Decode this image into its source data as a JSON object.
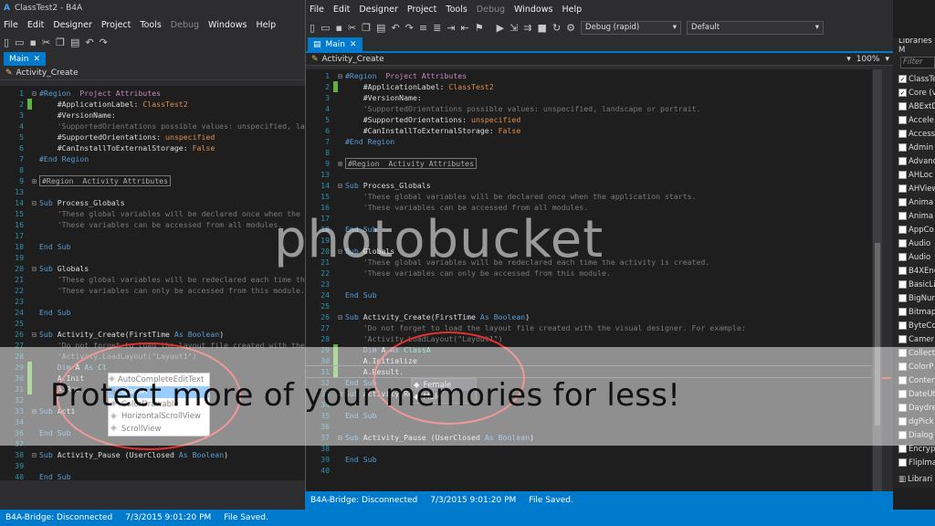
{
  "back_window": {
    "title": "ClassTest2 - B4A",
    "menu": [
      "File",
      "Edit",
      "Designer",
      "Project",
      "Tools",
      "Debug",
      "Windows",
      "Help"
    ],
    "tab": "Main",
    "sub_header": "Activity_Create",
    "status": [
      "B4A-Bridge: Disconnected",
      "7/3/2015 9:01:20 PM",
      "File Saved."
    ]
  },
  "front_window": {
    "menu": [
      "File",
      "Edit",
      "Designer",
      "Project",
      "Tools",
      "Debug",
      "Windows",
      "Help"
    ],
    "build_config": "Debug (rapid)",
    "device": "Default",
    "tab": "Main",
    "sub_header": "Activity_Create",
    "zoom": "100%",
    "status": [
      "B4A-Bridge: Disconnected",
      "7/3/2015 9:01:20 PM",
      "File Saved."
    ]
  },
  "libraries": {
    "header": "Libraries M",
    "filter_placeholder": "Filter",
    "items": [
      {
        "label": "ClassTe",
        "checked": true
      },
      {
        "label": "Core (v",
        "checked": true
      },
      {
        "label": "ABExtD",
        "checked": false
      },
      {
        "label": "Accele",
        "checked": false
      },
      {
        "label": "Access",
        "checked": false
      },
      {
        "label": "Admin",
        "checked": false
      },
      {
        "label": "Advanc",
        "checked": false
      },
      {
        "label": "AHLoc",
        "checked": false
      },
      {
        "label": "AHView",
        "checked": false
      },
      {
        "label": "Anima",
        "checked": false
      },
      {
        "label": "Anima",
        "checked": false
      },
      {
        "label": "AppCo",
        "checked": false
      },
      {
        "label": "Audio",
        "checked": false
      },
      {
        "label": "Audio",
        "checked": false
      },
      {
        "label": "B4XEnc",
        "checked": false
      },
      {
        "label": "BasicLi",
        "checked": false
      },
      {
        "label": "BigNur",
        "checked": false
      },
      {
        "label": "Bitmap",
        "checked": false
      },
      {
        "label": "ByteCo",
        "checked": false
      },
      {
        "label": "Camer",
        "checked": false
      },
      {
        "label": "Collect",
        "checked": false
      },
      {
        "label": "ColorP",
        "checked": false
      },
      {
        "label": "Conten",
        "checked": false
      },
      {
        "label": "DateUt",
        "checked": false
      },
      {
        "label": "Daydre",
        "checked": false
      },
      {
        "label": "dgPick",
        "checked": false
      },
      {
        "label": "Dialog",
        "checked": false
      },
      {
        "label": "Encryp",
        "checked": false
      },
      {
        "label": "FlipIma",
        "checked": false
      }
    ],
    "footer": "Librari"
  },
  "back_popup": {
    "items": [
      "AutoCompleteEditText",
      "ClassA",
      "ColorDrawable",
      "HorizontalScrollView",
      "ScrollView"
    ],
    "selected_index": 1
  },
  "front_popup": {
    "items": [
      "Female",
      "Male"
    ],
    "selected_index": 0
  },
  "watermark": {
    "logo": "photobucket",
    "banner": "Protect more of your memories for less!"
  }
}
